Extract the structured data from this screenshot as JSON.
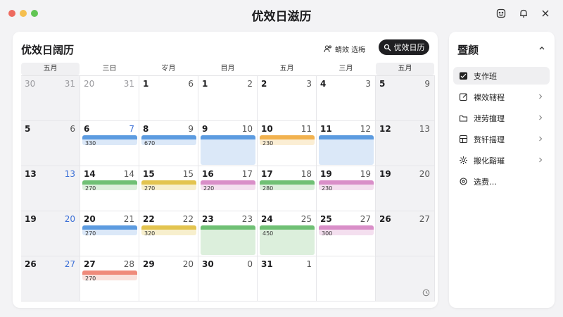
{
  "window": {
    "title": "优效日滋历"
  },
  "calendar": {
    "title": "优效日阔历",
    "filter_label": "蜻效 选梅",
    "primary_label": "优效日历",
    "weekdays": [
      "五月",
      "三日",
      "㞮月",
      "目月",
      "五月",
      "三月",
      "五月"
    ],
    "weeks": [
      [
        {
          "d": "30",
          "r": "31",
          "dim": true,
          "grey": true
        },
        {
          "d": "20",
          "r": "31",
          "dim": true
        },
        {
          "d": "1",
          "r": "6"
        },
        {
          "d": "1",
          "r": "2"
        },
        {
          "d": "2",
          "r": "3"
        },
        {
          "d": "4",
          "r": "3"
        },
        {
          "d": "5",
          "r": "9",
          "grey": true
        }
      ],
      [
        {
          "d": "5",
          "r": "6",
          "grey": true
        },
        {
          "d": "6",
          "r": "7",
          "rblue": true
        },
        {
          "d": "8",
          "r": "9"
        },
        {
          "d": "9",
          "r": "10"
        },
        {
          "d": "10",
          "r": "11"
        },
        {
          "d": "11",
          "r": "12"
        },
        {
          "d": "12",
          "r": "13",
          "grey": true
        }
      ],
      [
        {
          "d": "13",
          "r": "13",
          "grey": true,
          "rblue": true
        },
        {
          "d": "14",
          "r": "14"
        },
        {
          "d": "15",
          "r": "15"
        },
        {
          "d": "16",
          "r": "17"
        },
        {
          "d": "17",
          "r": "18"
        },
        {
          "d": "19",
          "r": "19"
        },
        {
          "d": "19",
          "r": "20",
          "grey": true
        }
      ],
      [
        {
          "d": "19",
          "r": "20",
          "grey": true,
          "rblue": true
        },
        {
          "d": "20",
          "r": "21"
        },
        {
          "d": "22",
          "r": "22"
        },
        {
          "d": "23",
          "r": "23"
        },
        {
          "d": "24",
          "r": "25"
        },
        {
          "d": "25",
          "r": "27"
        },
        {
          "d": "26",
          "r": "27",
          "grey": true
        }
      ],
      [
        {
          "d": "26",
          "r": "27",
          "grey": true,
          "rblue": true
        },
        {
          "d": "27",
          "r": "28"
        },
        {
          "d": "29",
          "r": "20"
        },
        {
          "d": "30",
          "r": "0"
        },
        {
          "d": "31",
          "r": "1"
        },
        {
          "d": "",
          "r": ""
        },
        {
          "d": "",
          "r": "",
          "grey": true
        }
      ]
    ],
    "events": [
      {
        "week": 1,
        "col": 1,
        "span": 1,
        "color": "blue",
        "text": "330"
      },
      {
        "week": 1,
        "col": 2,
        "span": 1,
        "color": "blue",
        "text": "670"
      },
      {
        "week": 1,
        "col": 3,
        "span": 1,
        "color": "blue",
        "text": ""
      },
      {
        "week": 1,
        "col": 4,
        "span": 1,
        "color": "orange",
        "text": "230"
      },
      {
        "week": 1,
        "col": 5,
        "span": 1,
        "color": "blue",
        "text": ""
      },
      {
        "week": 2,
        "col": 1,
        "span": 1,
        "color": "green",
        "text": "270"
      },
      {
        "week": 2,
        "col": 2,
        "span": 1,
        "color": "yellow",
        "text": "270"
      },
      {
        "week": 2,
        "col": 3,
        "span": 1,
        "color": "pink",
        "text": "220"
      },
      {
        "week": 2,
        "col": 4,
        "span": 1,
        "color": "green",
        "text": "280"
      },
      {
        "week": 2,
        "col": 5,
        "span": 1,
        "color": "pink",
        "text": "230"
      },
      {
        "week": 3,
        "col": 1,
        "span": 1,
        "color": "blue",
        "text": "270"
      },
      {
        "week": 3,
        "col": 2,
        "span": 1,
        "color": "yellow",
        "text": "320"
      },
      {
        "week": 3,
        "col": 3,
        "span": 1,
        "color": "green",
        "text": ""
      },
      {
        "week": 3,
        "col": 4,
        "span": 1,
        "color": "green",
        "text": "450"
      },
      {
        "week": 3,
        "col": 5,
        "span": 1,
        "color": "pink",
        "text": "300"
      },
      {
        "week": 4,
        "col": 1,
        "span": 1,
        "color": "red",
        "text": "270"
      }
    ]
  },
  "sidebar": {
    "title": "暨颜",
    "items": [
      {
        "label": "支作班",
        "icon": "calendar-icon",
        "active": true,
        "chevron": false
      },
      {
        "label": "裸效辖程",
        "icon": "edit-icon",
        "active": false,
        "chevron": true
      },
      {
        "label": "泄劳擅理",
        "icon": "folder-icon",
        "active": false,
        "chevron": true
      },
      {
        "label": "赘钎摇理",
        "icon": "board-icon",
        "active": false,
        "chevron": true
      },
      {
        "label": "搬化谿璀",
        "icon": "gear-icon",
        "active": false,
        "chevron": true
      },
      {
        "label": "选费…",
        "icon": "settings-icon",
        "active": false,
        "chevron": false
      }
    ]
  }
}
